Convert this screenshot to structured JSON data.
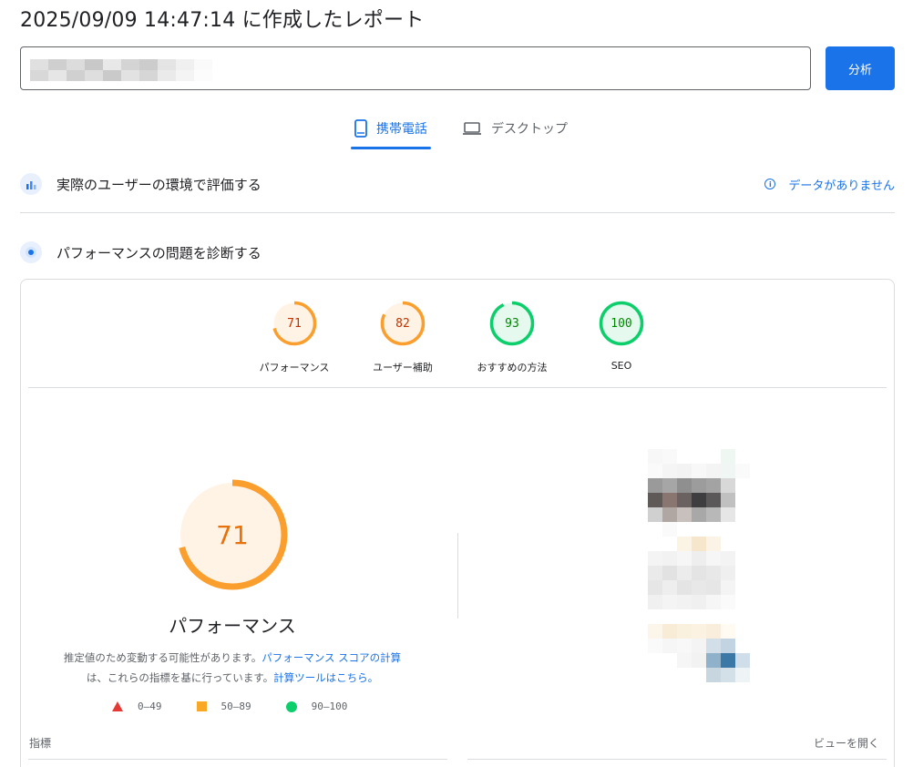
{
  "header": {
    "title": "2025/09/09 14:47:14 に作成したレポート"
  },
  "url_field": {
    "value_obscured": true
  },
  "analyze_button": {
    "label": "分析"
  },
  "tabs": [
    {
      "label": "携帯電話",
      "icon": "smartphone-icon",
      "active": true
    },
    {
      "label": "デスクトップ",
      "icon": "laptop-icon",
      "active": false
    }
  ],
  "field_data": {
    "title": "実際のユーザーの環境で評価する",
    "status_link": "データがありません"
  },
  "lab_data": {
    "title": "パフォーマンスの問題を診断する"
  },
  "scores": [
    {
      "label": "パフォーマンス",
      "value": "71",
      "color": "#fa9e2d",
      "fraction": 0.71
    },
    {
      "label": "ユーザー補助",
      "value": "82",
      "color": "#fa9e2d",
      "fraction": 0.82
    },
    {
      "label": "おすすめの方法",
      "value": "93",
      "color": "#0cce6b",
      "fraction": 0.93
    },
    {
      "label": "SEO",
      "value": "100",
      "color": "#0cce6b",
      "fraction": 1.0
    }
  ],
  "performance": {
    "score": "71",
    "fraction": 0.71,
    "title": "パフォーマンス",
    "desc_1": "推定値のため変動する可能性があります。",
    "link_1": "パフォーマンス スコアの計算",
    "desc_2": "は、これらの指標を基に行っています。",
    "link_2": "計算ツールはこちら。"
  },
  "legend": [
    {
      "label": "0–49",
      "shape": "triangle",
      "color": "#e53935"
    },
    {
      "label": "50–89",
      "shape": "square",
      "color": "#f9a825"
    },
    {
      "label": "90–100",
      "shape": "circle",
      "color": "#0cce6b"
    }
  ],
  "metrics": {
    "label": "指標",
    "view_link": "ビューを開く"
  },
  "colors": {
    "accent": "#1a73e8",
    "average": "#fa9e2d",
    "pass": "#0cce6b",
    "fail": "#e53935"
  }
}
